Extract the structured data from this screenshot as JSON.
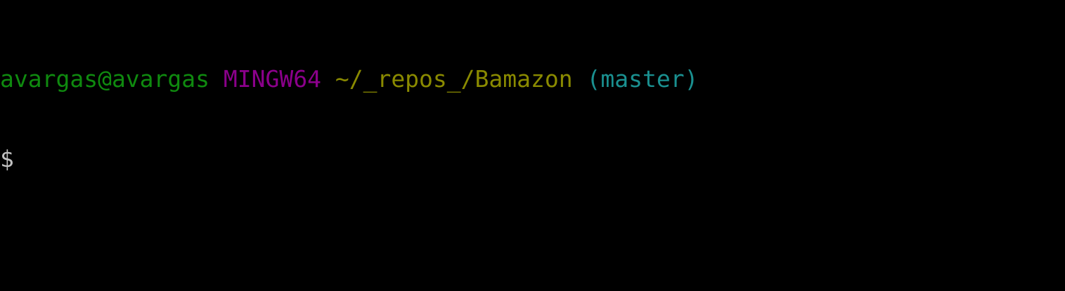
{
  "terminal": {
    "prompt_line": {
      "user_host": "avargas@avargas",
      "system": "MINGW64",
      "path": "~/_repos_/Bamazon",
      "branch": "(master)"
    },
    "prompt_symbol": "$"
  },
  "colors": {
    "background": "#000000",
    "user_host": "#0f8a0f",
    "system": "#8b008b",
    "path": "#8a8a00",
    "branch": "#1a9090",
    "prompt_symbol": "#c0c0c0"
  }
}
